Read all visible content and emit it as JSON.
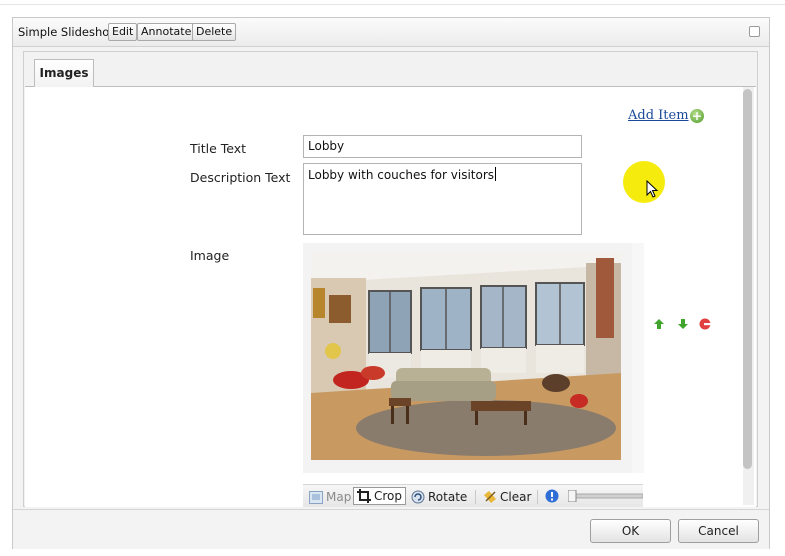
{
  "dialog": {
    "title": "Simple Slideshow",
    "toolbar": {
      "edit": "Edit",
      "annotate": "Annotate",
      "delete": "Delete"
    }
  },
  "tabs": [
    {
      "label": "Images",
      "active": true
    }
  ],
  "form": {
    "add_item_label": "Add Item",
    "title_text_label": "Title Text",
    "title_text_value": "Lobby",
    "description_text_label": "Description Text",
    "description_text_value": "Lobby with couches for visitors",
    "image_label": "Image"
  },
  "image_toolbar": {
    "map": "Map",
    "crop": "Crop",
    "rotate": "Rotate",
    "clear": "Clear"
  },
  "footer": {
    "ok": "OK",
    "cancel": "Cancel"
  },
  "icons": {
    "add": "plus-circle-icon",
    "move_up": "arrow-up-icon",
    "move_down": "arrow-down-icon",
    "remove": "minus-circle-icon",
    "info": "info-icon"
  },
  "colors": {
    "link": "#1a4a9c",
    "add_green": "#4f9a2a",
    "remove_red": "#e04040",
    "highlight": "#f4ea00"
  }
}
